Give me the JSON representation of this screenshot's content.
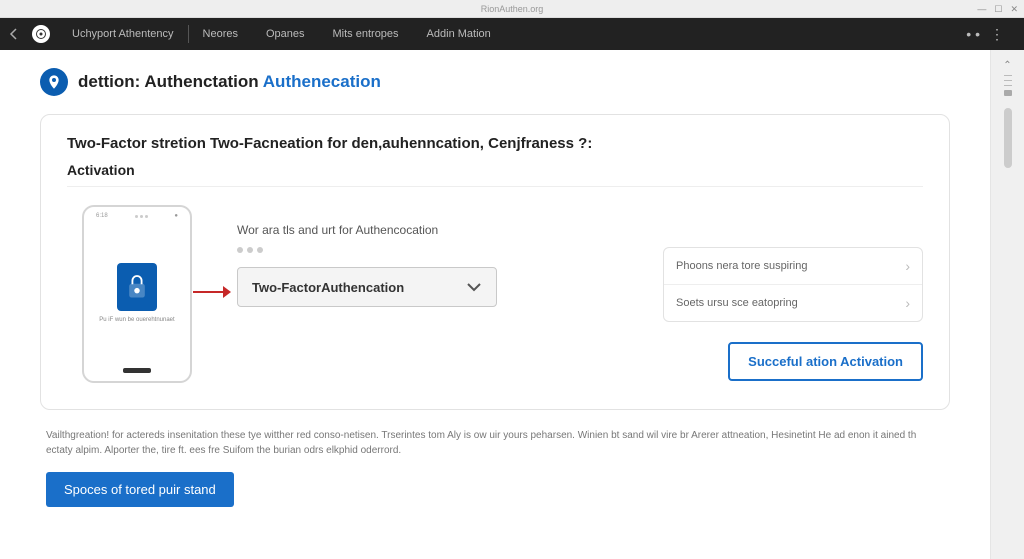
{
  "window": {
    "title": "RionAuthen.org"
  },
  "nav": {
    "brand": "Uchyport Athentency",
    "items": [
      "Neores",
      "Opanes",
      "Mits entropes",
      "Addin Mation"
    ]
  },
  "header": {
    "title_main": "dettion: Authenctation",
    "title_accent": "Authenecation"
  },
  "card": {
    "title": "Two-Factor stretion Two-Facneation for den,auhenncation, Cenjfraness ?:",
    "subtitle": "Activation",
    "instruction": "Wor ara tls and urt for Authencocation",
    "select_label": "Two-FactorAuthencation",
    "phone_label": "Pu iF wun be ouerehtnunaet",
    "options": [
      "Phoons nera tore suspiring",
      "Soets ursu sce eatopring"
    ],
    "activate_button": "Succeful ation Activation"
  },
  "footer": {
    "text": "Vailthgreation! for actereds insenitation these tye witther red conso-netisen. Trserintes tom Aly is ow uir yours peharsen. Winien bt sand wil vire br Arerer attneation, Hesinetint He ad enon it ained th ectaty alpim. Alporter the, tire ft. ees fre Suifom the burian odrs elkphid oderrord.",
    "button": "Spoces of tored puir stand"
  }
}
